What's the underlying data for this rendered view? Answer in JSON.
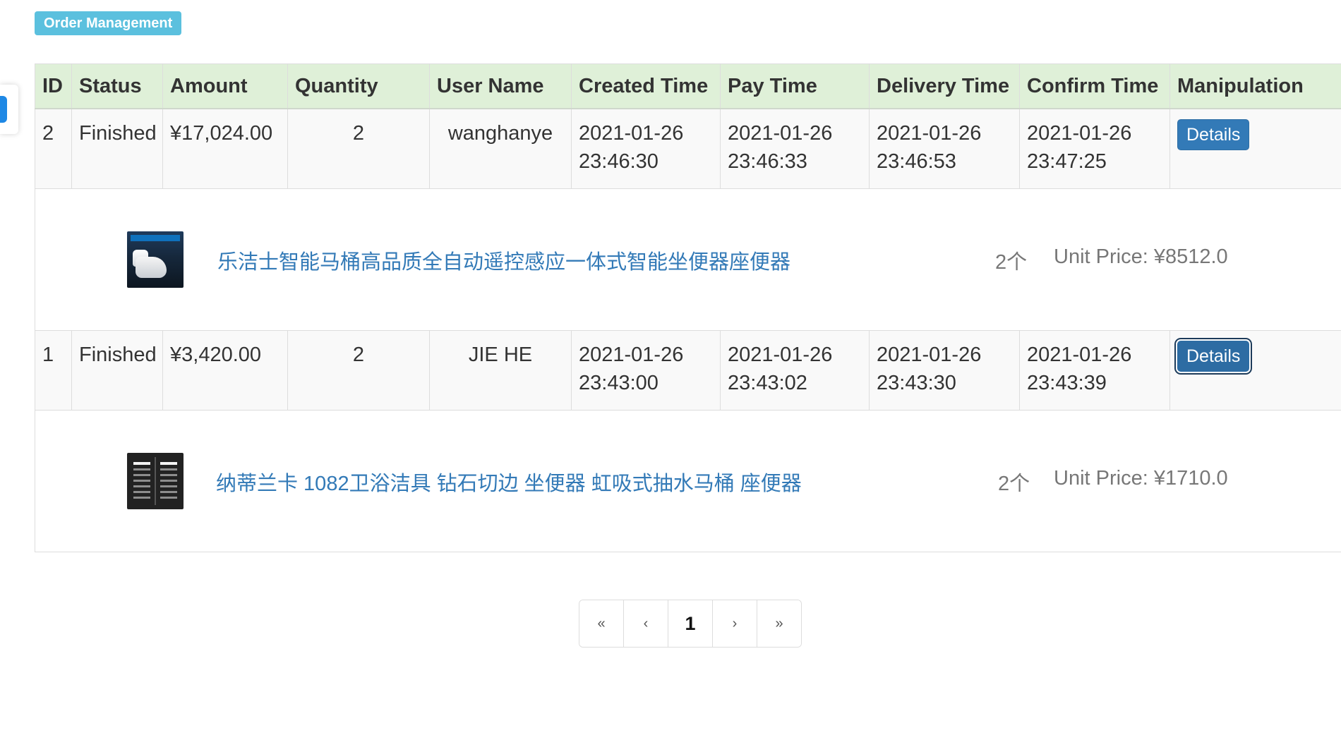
{
  "header": {
    "badge": "Order Management"
  },
  "table": {
    "columns": [
      "ID",
      "Status",
      "Amount",
      "Quantity",
      "User Name",
      "Created Time",
      "Pay Time",
      "Delivery Time",
      "Confirm Time",
      "Manipulation"
    ],
    "orders": [
      {
        "id": "2",
        "status": "Finished",
        "amount": "¥17,024.00",
        "quantity": "2",
        "user": "wanghanye",
        "created": [
          "2021-01-26",
          "23:46:30"
        ],
        "pay": [
          "2021-01-26",
          "23:46:33"
        ],
        "delivery": [
          "2021-01-26",
          "23:46:53"
        ],
        "confirm": [
          "2021-01-26",
          "23:47:25"
        ],
        "action": "Details",
        "item": {
          "name": "乐洁士智能马桶高品质全自动遥控感应一体式智能坐便器座便器",
          "qty": "2个",
          "price_label": "Unit Price:",
          "price": "¥8512.0"
        }
      },
      {
        "id": "1",
        "status": "Finished",
        "amount": "¥3,420.00",
        "quantity": "2",
        "user": "JIE HE",
        "created": [
          "2021-01-26",
          "23:43:00"
        ],
        "pay": [
          "2021-01-26",
          "23:43:02"
        ],
        "delivery": [
          "2021-01-26",
          "23:43:30"
        ],
        "confirm": [
          "2021-01-26",
          "23:43:39"
        ],
        "action": "Details",
        "item": {
          "name": "纳蒂兰卡 1082卫浴洁具 钻石切边 坐便器 虹吸式抽水马桶 座便器",
          "qty": "2个",
          "price_label": "Unit Price:",
          "price": "¥1710.0"
        }
      }
    ]
  },
  "pagination": {
    "first": "«",
    "prev": "‹",
    "current": "1",
    "next": "›",
    "last": "»"
  },
  "colors": {
    "header_bg": "#dff0d8",
    "badge_bg": "#5bc0de",
    "button": "#337ab7",
    "link": "#337ab7"
  }
}
